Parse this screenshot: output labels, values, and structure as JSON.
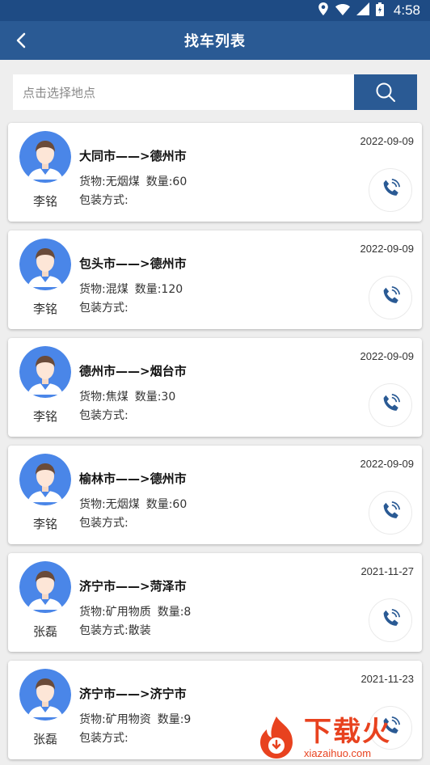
{
  "status_bar": {
    "time": "4:58"
  },
  "header": {
    "title": "找车列表"
  },
  "search": {
    "placeholder": "点击选择地点"
  },
  "colors": {
    "primary": "#2a5a94",
    "avatar_bg": "#4a86e8",
    "phone_icon": "#2a5a94"
  },
  "cards": [
    {
      "name": "李铭",
      "route": "大同市——>德州市",
      "cargo": "货物:无烟煤",
      "quantity": "数量:60",
      "packing": "包装方式:",
      "date": "2022-09-09"
    },
    {
      "name": "李铭",
      "route": "包头市——>德州市",
      "cargo": "货物:混煤",
      "quantity": "数量:120",
      "packing": "包装方式:",
      "date": "2022-09-09"
    },
    {
      "name": "李铭",
      "route": "德州市——>烟台市",
      "cargo": "货物:焦煤",
      "quantity": "数量:30",
      "packing": "包装方式:",
      "date": "2022-09-09"
    },
    {
      "name": "李铭",
      "route": "榆林市——>德州市",
      "cargo": "货物:无烟煤",
      "quantity": "数量:60",
      "packing": "包装方式:",
      "date": "2022-09-09"
    },
    {
      "name": "张磊",
      "route": "济宁市——>菏泽市",
      "cargo": "货物:矿用物质",
      "quantity": "数量:8",
      "packing": "包装方式:散装",
      "date": "2021-11-27"
    },
    {
      "name": "张磊",
      "route": "济宁市——>济宁市",
      "cargo": "货物:矿用物资",
      "quantity": "数量:9",
      "packing": "包装方式:",
      "date": "2021-11-23"
    }
  ],
  "watermark": {
    "title": "下载火",
    "url": "xiazaihuo.com"
  }
}
